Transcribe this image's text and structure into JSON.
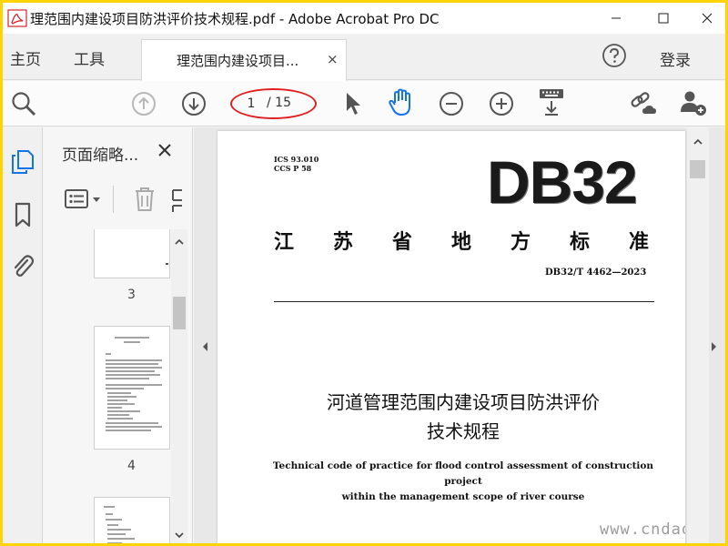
{
  "window": {
    "title": "理范围内建设项目防洪评价技术规程.pdf - Adobe Acrobat Pro DC"
  },
  "nav": {
    "home": "主页",
    "tools": "工具",
    "doc_tab_label": "理范围内建设项目...",
    "doc_tab_close": "×",
    "login": "登录"
  },
  "toolbar": {
    "current_page": "1",
    "page_total": "/ 15"
  },
  "thumbnails": {
    "title": "页面缩略...",
    "pages": [
      {
        "number": "3"
      },
      {
        "number": "4"
      }
    ]
  },
  "document": {
    "ics": "ICS 93.010",
    "ccs": "CCS P 58",
    "code": "DB32",
    "standard_title": "江苏省地方标准",
    "standard_number": "DB32/T 4462—2023",
    "cn_title_line1": "河道管理范围内建设项目防洪评价",
    "cn_title_line2": "技术规程",
    "en_title_line1": "Technical code of practice for flood control assessment of construction project",
    "en_title_line2": "within the management scope of river course"
  },
  "watermark": "www.cndao.com",
  "colors": {
    "frame": "#ffd400",
    "hand_active": "#1473e6",
    "annotation": "#e02020",
    "pdf_red": "#d9232d"
  }
}
